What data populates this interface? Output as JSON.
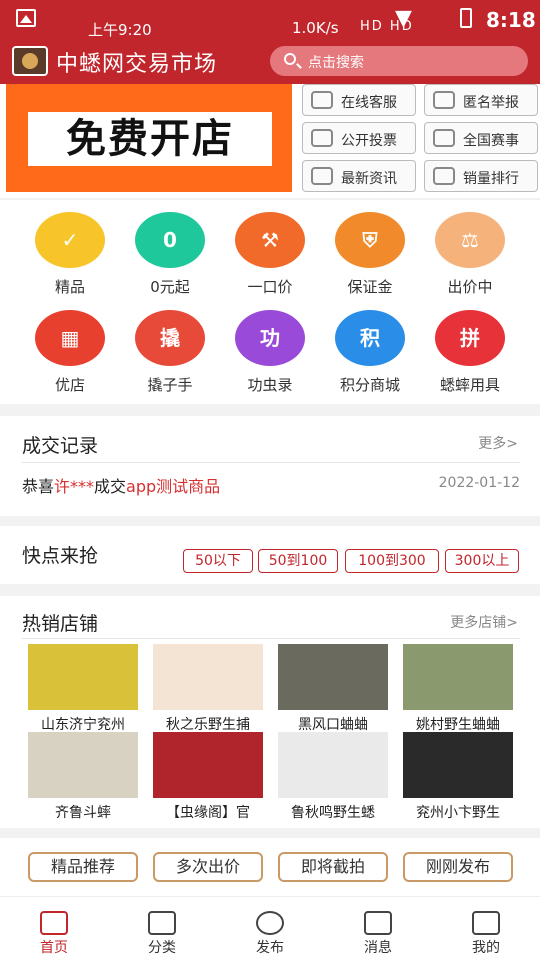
{
  "status_bar": {
    "time_left": "上午9:20",
    "network_speed": "1.0K/s",
    "signal_text": "HD HD",
    "time_right": "8:18"
  },
  "header": {
    "title": "中蟋网交易市场",
    "search_placeholder": "点击搜索"
  },
  "banner": {
    "text": "免费开店"
  },
  "quick_buttons": [
    {
      "label": "在线客服",
      "icon": "headset-icon"
    },
    {
      "label": "匿名举报",
      "icon": "alert-icon"
    },
    {
      "label": "公开投票",
      "icon": "vote-icon"
    },
    {
      "label": "全国赛事",
      "icon": "trophy-icon"
    },
    {
      "label": "最新资讯",
      "icon": "news-icon"
    },
    {
      "label": "销量排行",
      "icon": "ranking-icon"
    }
  ],
  "grid_items": [
    {
      "label": "精品",
      "icon": "featured-icon",
      "glyph": "✓",
      "color": "#f7c52a"
    },
    {
      "label": "0元起",
      "icon": "zero-start-icon",
      "glyph": "0",
      "color": "#1ec89a"
    },
    {
      "label": "一口价",
      "icon": "fixed-price-icon",
      "glyph": "⚒",
      "color": "#f26a2a"
    },
    {
      "label": "保证金",
      "icon": "deposit-shield-icon",
      "glyph": "⛨",
      "color": "#f08a2a"
    },
    {
      "label": "出价中",
      "icon": "bidding-icon",
      "glyph": "⚖",
      "color": "#f5b27a"
    },
    {
      "label": "优店",
      "icon": "shop-icon",
      "glyph": "▦",
      "color": "#e8402e"
    },
    {
      "label": "撬子手",
      "icon": "prying-icon",
      "glyph": "撬",
      "color": "#e84a3a"
    },
    {
      "label": "功虫录",
      "icon": "merit-icon",
      "glyph": "功",
      "color": "#9a4ad8"
    },
    {
      "label": "积分商城",
      "icon": "points-mall-icon",
      "glyph": "积",
      "color": "#2a8ee8"
    },
    {
      "label": "蟋蟀用具",
      "icon": "cricket-tools-icon",
      "glyph": "拼",
      "color": "#e8323a"
    }
  ],
  "deals": {
    "title": "成交记录",
    "more": "更多>",
    "line_prefix": "恭喜",
    "user": "许***",
    "line_mid": "成交",
    "product": "app测试商品",
    "date": "2022-01-12"
  },
  "quick_grab": {
    "title": "快点来抢",
    "tags": [
      "50以下",
      "50到100",
      "100到300",
      "300以上"
    ]
  },
  "shops": {
    "title": "热销店铺",
    "more": "更多店铺>",
    "items": [
      {
        "name": "山东济宁兖州",
        "color": "#d9c23a"
      },
      {
        "name": "秋之乐野生捕",
        "color": "#f3e4d4"
      },
      {
        "name": "黑风口蛐蛐",
        "color": "#6a6a5e"
      },
      {
        "name": "姚村野生蛐蛐",
        "color": "#8a9a6e"
      },
      {
        "name": "齐鲁斗蟀",
        "color": "#d8d2c2"
      },
      {
        "name": "【虫缘阁】官",
        "color": "#b0242c"
      },
      {
        "name": "鲁秋鸣野生蟋",
        "color": "#eaeaea"
      },
      {
        "name": "兖州小卞野生",
        "color": "#2a2a2a"
      }
    ]
  },
  "chips": [
    "精品推荐",
    "多次出价",
    "即将截拍",
    "刚刚发布"
  ],
  "tabbar": [
    {
      "label": "首页",
      "icon": "home-icon"
    },
    {
      "label": "分类",
      "icon": "category-icon"
    },
    {
      "label": "发布",
      "icon": "publish-icon"
    },
    {
      "label": "消息",
      "icon": "message-icon"
    },
    {
      "label": "我的",
      "icon": "profile-icon"
    }
  ]
}
